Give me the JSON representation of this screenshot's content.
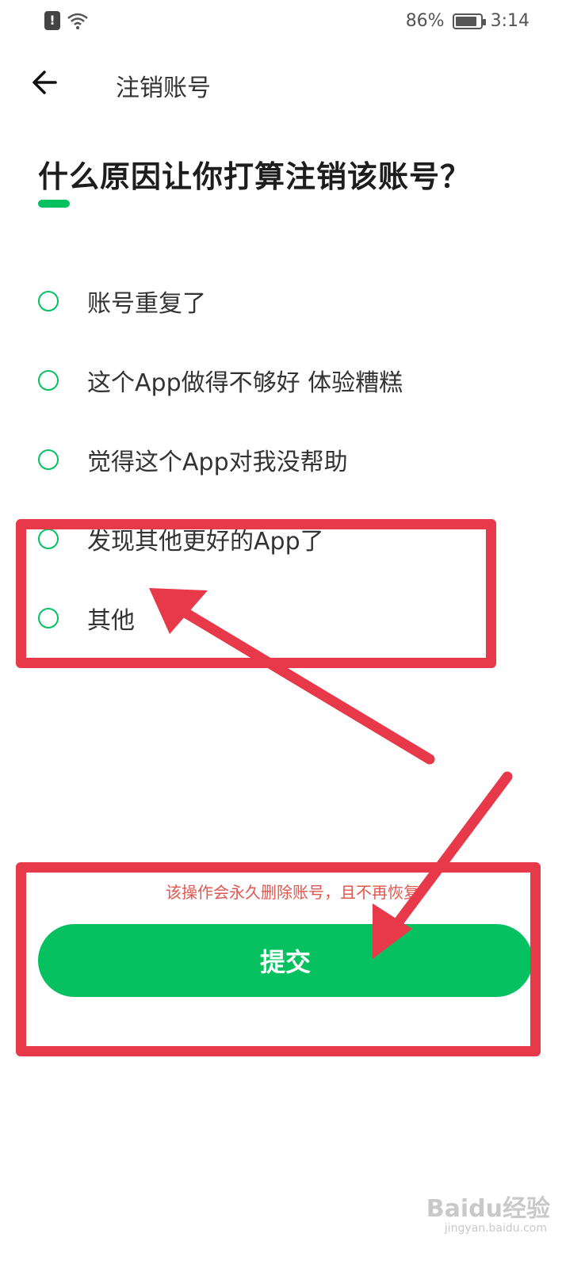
{
  "status": {
    "battery": "86%",
    "time": "3:14",
    "battery_level": 0.86
  },
  "header": {
    "title": "注销账号"
  },
  "question": "什么原因让你打算注销该账号？",
  "options": [
    {
      "label": "账号重复了"
    },
    {
      "label": "这个App做得不够好 体验糟糕"
    },
    {
      "label": "觉得这个App对我没帮助"
    },
    {
      "label": "发现其他更好的App了"
    },
    {
      "label": "其他"
    }
  ],
  "warning": "该操作会永久删除账号，且不再恢复",
  "submit_label": "提交",
  "watermark": {
    "brand": "Baidu经验",
    "url": "jingyan.baidu.com"
  },
  "colors": {
    "accent": "#07c160",
    "annotation": "#e8394a",
    "warning": "#e0574f"
  }
}
